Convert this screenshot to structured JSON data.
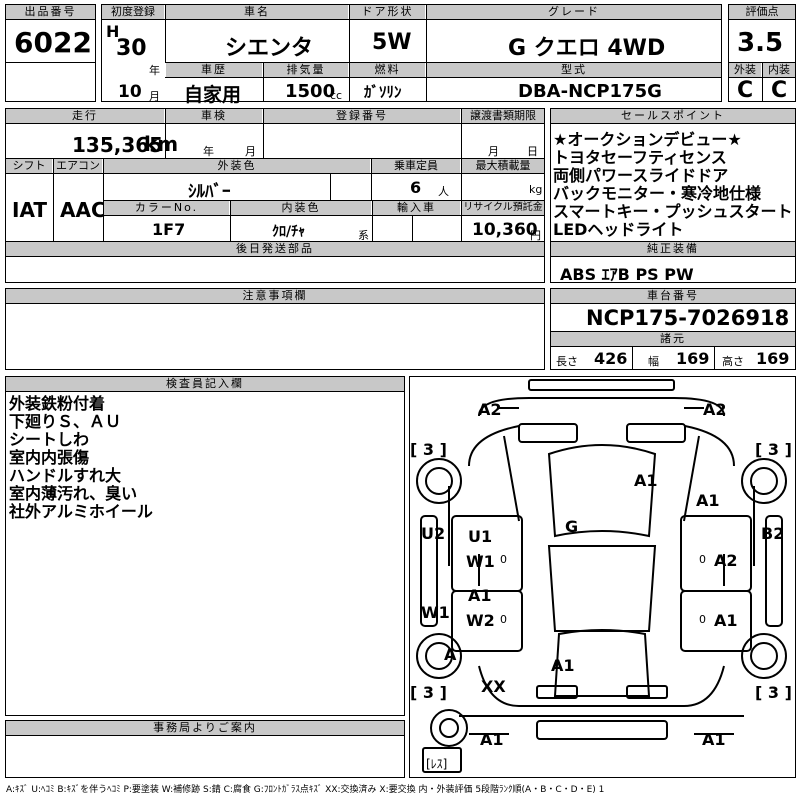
{
  "header": {
    "lot_label": "出品番号",
    "lot": "6022",
    "first_reg_label": "初度登録",
    "era": "H",
    "year_num": "30",
    "year_unit": "年",
    "month_num": "10",
    "month_unit": "月",
    "car_name_label": "車名",
    "car_name": "シエンタ",
    "door_label": "ドア形状",
    "door": "5W",
    "grade_label": "グレード",
    "grade": "G クエロ 4WD",
    "score_label": "評価点",
    "score": "3.5",
    "ext_label": "外装",
    "ext": "C",
    "int_label": "内装",
    "int": "C",
    "history_label": "車歴",
    "history": "自家用",
    "disp_label": "排気量",
    "disp": "1500",
    "disp_unit": "cc",
    "fuel_label": "燃料",
    "fuel": "ｶﾞｿﾘﾝ",
    "model_label": "型式",
    "model": "DBA-NCP175G"
  },
  "row2": {
    "mileage_label": "走行",
    "mileage": "135,365",
    "mileage_unit": "km",
    "inspection_label": "車検",
    "insp_year_unit": "年",
    "insp_month_unit": "月",
    "regno_label": "登録番号",
    "transfer_label": "譲渡書類期限",
    "transfer_month_unit": "月",
    "transfer_day_unit": "日",
    "shift_label": "シフト",
    "shift": "IAT",
    "ac_label": "エアコン",
    "ac": "AAC",
    "color_label": "外装色",
    "color": "ｼﾙﾊﾞｰ",
    "seats_label": "乗車定員",
    "seats": "6",
    "seats_unit": "人",
    "load_label": "最大積載量",
    "load_unit": "kg",
    "colorno_label": "カラーNo.",
    "colorno": "1F7",
    "interior_label": "内装色",
    "interior": "ｸﾛ/ﾁｬ",
    "interior_unit": "系",
    "import_label": "輸入車",
    "recycle_label": "リサイクル預託金",
    "recycle": "10,360",
    "recycle_unit": "円",
    "later_label": "後日発送部品"
  },
  "sales": {
    "label": "セールスポイント",
    "items": [
      "★オークションデビュー★",
      "トヨタセーフティセンス",
      "両側パワースライドドア",
      "バックモニター・寒冷地仕様",
      "スマートキー・プッシュスタート",
      "LEDヘッドライト"
    ]
  },
  "equipment": {
    "label": "純正装備",
    "value": "ABS ｴｱB PS PW"
  },
  "notes": {
    "label": "注意事項欄"
  },
  "chassis": {
    "label": "車台番号",
    "value": "NCP175-7026918",
    "dims_label": "諸元",
    "len_label": "長さ",
    "len": "426",
    "wid_label": "幅",
    "wid": "169",
    "hgt_label": "高さ",
    "hgt": "169"
  },
  "inspector": {
    "label": "検査員記入欄",
    "items": [
      "外装鉄粉付着",
      "下廻りＳ、ＡＵ",
      "シートしわ",
      "室内内張傷",
      "ハンドルすれ大",
      "室内薄汚れ、臭い",
      "社外アルミホイール"
    ]
  },
  "office": {
    "label": "事務局よりご案内"
  },
  "diagram": {
    "marks": {
      "a2_l": "A2",
      "a2_r": "A2",
      "b3_tl": "[ 3 ]",
      "b3_tr": "[ 3 ]",
      "b3_bl": "[ 3 ]",
      "b3_br": "[ 3 ]",
      "a1_hood": "A1",
      "a1_rf": "A1",
      "g_glass": "G",
      "u2": "U2",
      "u1": "U1",
      "w1_door": "W1",
      "b2": "B2",
      "a2_door": "A2",
      "w1_side": "W1",
      "a1_door": "A1",
      "w2": "W2",
      "a1_rr": "A1",
      "a_wheel": "A",
      "a1_roof": "A1",
      "xx": "XX",
      "a1_bl": "A1",
      "a1_br": "A1",
      "less": "[ﾚｽ]",
      "zero1": "0",
      "zero2": "0",
      "zero3": "0",
      "zero4": "0"
    }
  },
  "legend": "A:ｷｽﾞ  U:ﾍｺﾐ  B:ｷｽﾞを伴うﾍｺﾐ  P:要塗装 W:補修跡 S:錆 C:腐食 G:ﾌﾛﾝﾄｶﾞﾗｽ点ｷｽﾞ  XX:交換済み  X:要交換  内・外装評価  5段階ﾗﾝｸ順(A・B・C・D・E) 1",
  "colors": {
    "header_bg": "#c8c8c8",
    "line": "#000000"
  }
}
